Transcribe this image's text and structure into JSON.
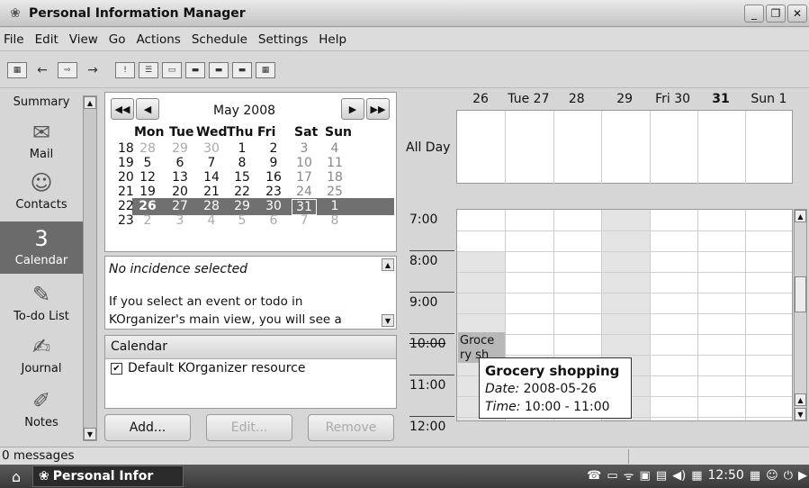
{
  "window": {
    "title": "Personal Information Manager",
    "buttons": [
      "_",
      "❐",
      "✕"
    ]
  },
  "menu": [
    "File",
    "Edit",
    "View",
    "Go",
    "Actions",
    "Schedule",
    "Settings",
    "Help"
  ],
  "sidebar": {
    "items": [
      {
        "label": "Summary",
        "icon": "summary-icon"
      },
      {
        "label": "Mail",
        "icon": "mail-icon"
      },
      {
        "label": "Contacts",
        "icon": "contacts-icon"
      },
      {
        "label": "Calendar",
        "icon": "calendar-icon",
        "active": true
      },
      {
        "label": "To-do List",
        "icon": "todo-icon"
      },
      {
        "label": "Journal",
        "icon": "journal-icon"
      },
      {
        "label": "Notes",
        "icon": "notes-icon"
      }
    ]
  },
  "datenav": {
    "month": "May 2008",
    "weekday_headers": [
      "Mon",
      "Tue",
      "Wed",
      "Thu",
      "Fri",
      "Sat",
      "Sun"
    ],
    "weeks": [
      {
        "num": "18",
        "days": [
          "28",
          "29",
          "30",
          "1",
          "2",
          "3",
          "4"
        ]
      },
      {
        "num": "19",
        "days": [
          "5",
          "6",
          "7",
          "8",
          "9",
          "10",
          "11"
        ]
      },
      {
        "num": "20",
        "days": [
          "12",
          "13",
          "14",
          "15",
          "16",
          "17",
          "18"
        ]
      },
      {
        "num": "21",
        "days": [
          "19",
          "20",
          "21",
          "22",
          "23",
          "24",
          "25"
        ]
      },
      {
        "num": "22",
        "days": [
          "26",
          "27",
          "28",
          "29",
          "30",
          "31",
          "1"
        ]
      },
      {
        "num": "23",
        "days": [
          "2",
          "3",
          "4",
          "5",
          "6",
          "7",
          "8"
        ]
      }
    ]
  },
  "incidence": {
    "title": "No incidence selected",
    "body": "If you select an event or todo in KOrganizer's main view, you will see a"
  },
  "resources": {
    "header": "Calendar",
    "items": [
      "Default KOrganizer resource"
    ],
    "buttons": {
      "add": "Add...",
      "edit": "Edit...",
      "remove": "Remove"
    }
  },
  "agenda": {
    "day_headers": [
      "26",
      "Tue 27",
      "28",
      "29",
      "Fri 30",
      "31",
      "Sun 1"
    ],
    "allday_label": "All Day",
    "times": [
      "7:00",
      "8:00",
      "9:00",
      "10:00",
      "11:00",
      "12:00"
    ],
    "event": {
      "title": "Grocery shopping",
      "short": "Groce ry sh"
    },
    "tooltip": {
      "title": "Grocery shopping",
      "date_label": "Date:",
      "date": "2008-05-26",
      "time_label": "Time:",
      "time": "10:00 - 11:00"
    }
  },
  "status": {
    "messages": "0 messages"
  },
  "taskbar": {
    "task": "Personal Infor",
    "clock": "12:50"
  }
}
